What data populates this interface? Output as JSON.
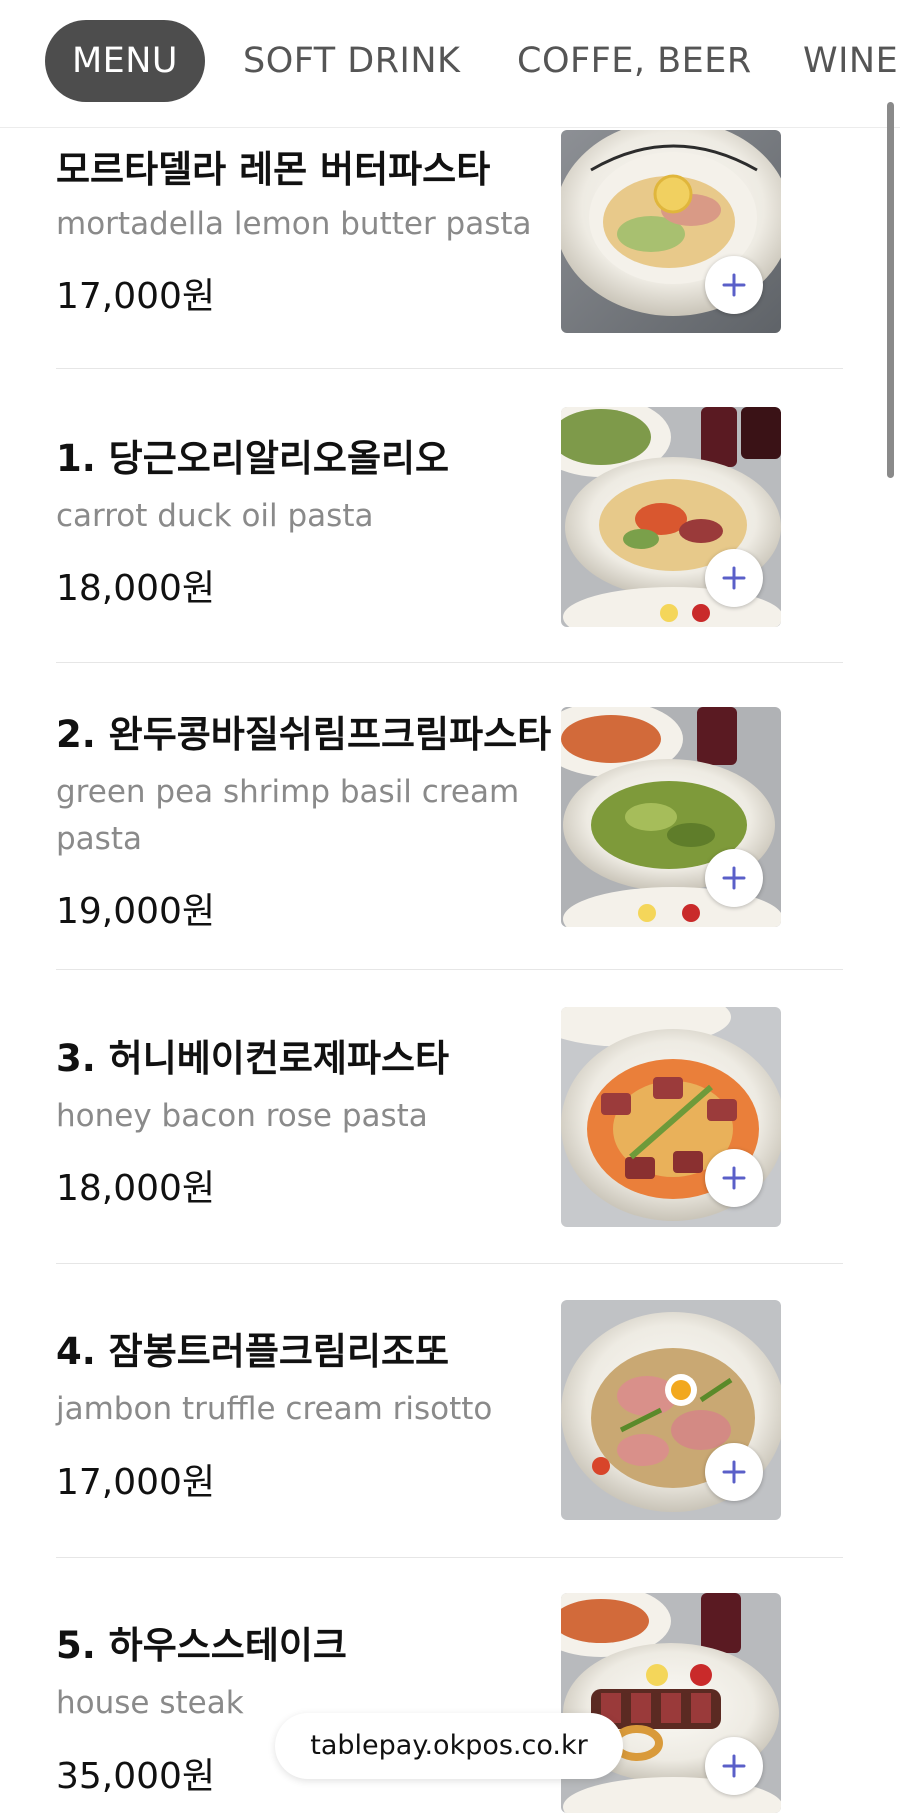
{
  "tabs": [
    {
      "label": "MENU",
      "active": true
    },
    {
      "label": "SOFT DRINK",
      "active": false
    },
    {
      "label": "COFFE, BEER",
      "active": false
    },
    {
      "label": "WINE",
      "active": false
    }
  ],
  "menu_items": [
    {
      "name": "모르타델라 레몬 버터파스타",
      "description": "mortadella lemon butter pasta",
      "price": "17,000원",
      "image": "pasta-plate-photo"
    },
    {
      "name": "1. 당근오리알리오올리오",
      "description": "carrot duck oil pasta",
      "price": "18,000원",
      "image": "pasta-plate-photo"
    },
    {
      "name": "2. 완두콩바질쉬림프크림파스타",
      "description": "green pea shrimp basil cream pasta",
      "price": "19,000원",
      "image": "pasta-plate-photo"
    },
    {
      "name": "3. 허니베이컨로제파스타",
      "description": "honey bacon rose pasta",
      "price": "18,000원",
      "image": "pasta-plate-photo"
    },
    {
      "name": "4. 잠봉트러플크림리조또",
      "description": "jambon truffle cream risotto",
      "price": "17,000원",
      "image": "risotto-plate-photo"
    },
    {
      "name": "5. 하우스스테이크",
      "description": "house steak",
      "price": "35,000원",
      "image": "steak-plate-photo"
    }
  ],
  "footer": {
    "domain": "tablepay.okpos.co.kr"
  },
  "colors": {
    "active_tab_bg": "#4d4d4d",
    "plus_icon": "#5a5fc8",
    "text_primary": "#111111",
    "text_secondary": "#8a8a8a"
  },
  "icons": {
    "add": "plus-icon"
  }
}
